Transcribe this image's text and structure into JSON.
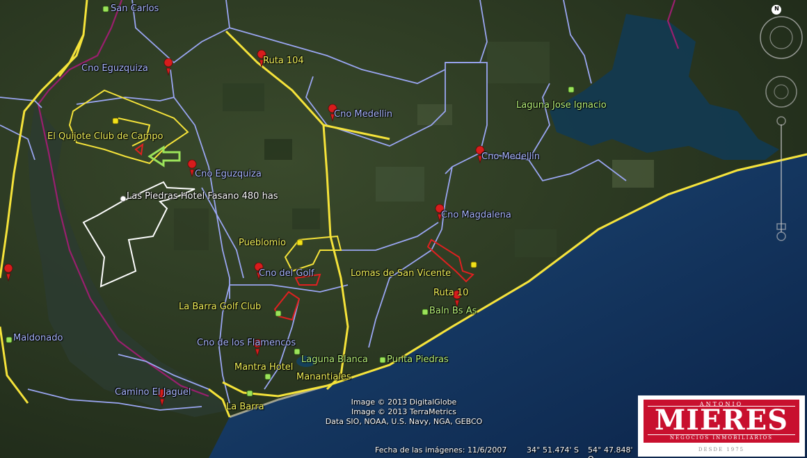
{
  "map": {
    "blue_labels": [
      {
        "text": "San Carlos"
      },
      {
        "text": "Cno Eguzquiza"
      },
      {
        "text": "Cno Eguzquiza"
      },
      {
        "text": "Cno Medellin"
      },
      {
        "text": "Cno Medellin"
      },
      {
        "text": "Cno Magdalena"
      },
      {
        "text": "Cno del Golf"
      },
      {
        "text": "Cno de los Flamencos"
      },
      {
        "text": "Camino El Jaguel"
      },
      {
        "text": "Maldonado"
      }
    ],
    "yellow_labels": [
      {
        "text": "Ruta 104"
      },
      {
        "text": "El Quijote Club de Campo"
      },
      {
        "text": "Pueblomio"
      },
      {
        "text": "Lomas de San Vicente"
      },
      {
        "text": "Ruta 10"
      },
      {
        "text": "La Barra Golf Club"
      },
      {
        "text": "Mantra Hotel"
      },
      {
        "text": "Manantiales"
      },
      {
        "text": "La Barra"
      }
    ],
    "green_labels": [
      {
        "text": "Laguna Jose Ignacio"
      },
      {
        "text": "Baln Bs As"
      },
      {
        "text": "Laguna Blanca"
      },
      {
        "text": "Punta Piedras"
      }
    ],
    "white_labels": [
      {
        "text": "Las Piedras Hotel Fasano 480 has"
      }
    ],
    "colors": {
      "roads_major": "#f5e33a",
      "roads_minor": "#9aa6f2",
      "boundary": "#9a1f6e",
      "property_white": "#ffffff",
      "property_red": "#e02020",
      "pin_red": "#d81c1c",
      "pin_yellow": "#f2e21a",
      "pin_green": "#9be35a",
      "ocean": "#0d2a55"
    }
  },
  "credits": {
    "line1": "Image © 2013 DigitalGlobe",
    "line2": "Image © 2013 TerraMetrics",
    "line3": "Data SIO, NOAA, U.S. Navy, NGA, GEBCO"
  },
  "status": {
    "date": "Fecha de las imágenes: 11/6/2007",
    "lat": "34° 51.474' S",
    "lon": "54° 47.848' O"
  },
  "logo": {
    "top": "ANTONIO",
    "name": "MIERES",
    "sub": "NEGOCIOS INMOBILIARIOS",
    "since": "DESDE 1975"
  },
  "controls": {
    "north": "N",
    "compass_icon": "compass-rose-icon",
    "zoom_icon": "zoom-slider-icon"
  }
}
